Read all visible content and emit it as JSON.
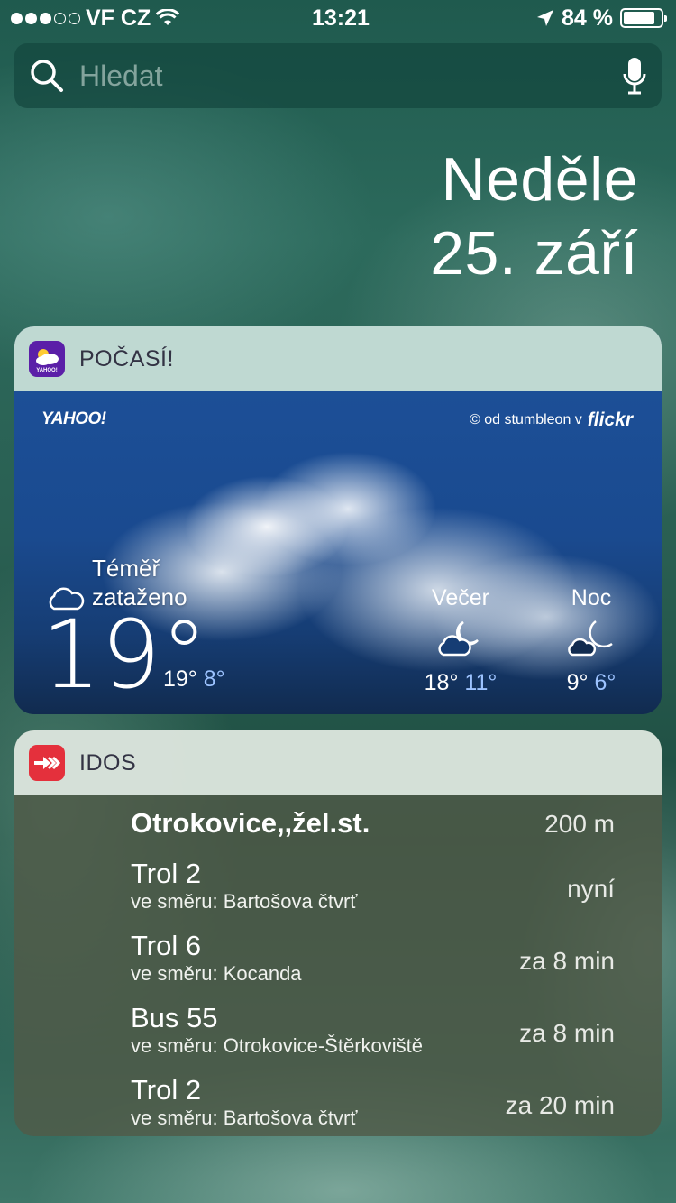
{
  "status": {
    "carrier": "VF CZ",
    "time": "13:21",
    "battery": "84 %",
    "battery_level": 0.84,
    "signal_bars_filled": 3,
    "signal_bars_total": 5
  },
  "search": {
    "placeholder": "Hledat"
  },
  "date": {
    "weekday": "Neděle",
    "day": "25. září"
  },
  "weather": {
    "title": "POČASÍ!",
    "brand": "YAHOO!",
    "photo_credit": "© od stumbleon v",
    "credit_source": "flickr",
    "condition_line1": "Téměř",
    "condition_line2": "zataženo",
    "temp": "19°",
    "high": "19°",
    "low": "8°",
    "evening": {
      "label": "Večer",
      "high": "18°",
      "low": "11°",
      "icon": "cloud-moon-icon"
    },
    "night": {
      "label": "Noc",
      "high": "9°",
      "low": "6°",
      "icon": "moon-cloud-icon"
    }
  },
  "idos": {
    "title": "IDOS",
    "station": {
      "name": "Otrokovice,,žel.st.",
      "distance": "200 m"
    },
    "departures": [
      {
        "line": "Trol 2",
        "direction": "ve směru: Bartošova čtvrť",
        "eta": "nyní"
      },
      {
        "line": "Trol 6",
        "direction": "ve směru: Kocanda",
        "eta": "za 8 min"
      },
      {
        "line": "Bus 55",
        "direction": "ve směru: Otrokovice-Štěrkoviště",
        "eta": "za 8 min"
      },
      {
        "line": "Trol 2",
        "direction": "ve směru: Bartošova čtvrť",
        "eta": "za 20 min"
      }
    ]
  },
  "colors": {
    "weather_icon_bg": "#5b1fa8",
    "idos_icon_bg": "#e4303c",
    "low_temp": "#9dc3ff"
  }
}
